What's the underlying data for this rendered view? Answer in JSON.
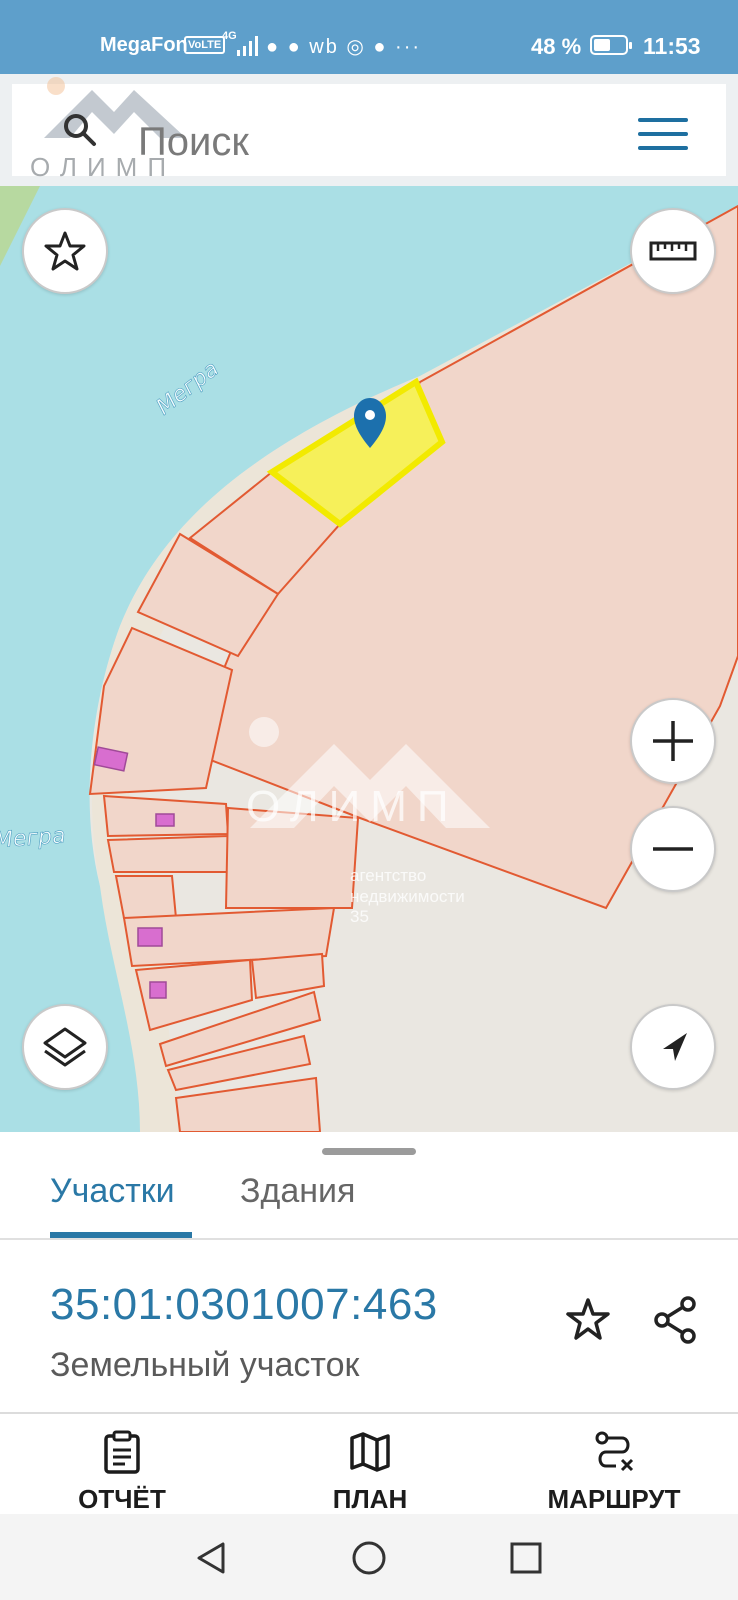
{
  "status_bar": {
    "carrier": "MegaFon",
    "volte": "VoLTE",
    "network": "4G",
    "notifications": "● ● wb ◎ ● ···",
    "battery": "48 %",
    "battery_level": 0.48,
    "time": "11:53"
  },
  "header": {
    "search_placeholder": "Поиск",
    "logo_text": "ОЛИМП"
  },
  "map": {
    "river_name_1": "Мегра",
    "river_name_2": "Мегра",
    "watermark": {
      "name": "ОЛИМП",
      "line1": "агентство",
      "line2": "недвижимости",
      "line3": "35"
    },
    "colors": {
      "water": "#aadfe5",
      "land": "#eae7e1",
      "parcel_fill": "#f1d6ca",
      "parcel_border": "#e25a32",
      "selected_parcel": "#f6f05a",
      "selected_border": "#f2ea00",
      "marker": "#1c70ad",
      "building": "#d86ecf"
    }
  },
  "sheet": {
    "tabs": [
      {
        "label": "Участки",
        "active": true
      },
      {
        "label": "Здания",
        "active": false
      }
    ],
    "parcel": {
      "cadastral_number": "35:01:0301007:463",
      "type": "Земельный участок"
    }
  },
  "actions": [
    {
      "label": "ОТЧЁТ",
      "icon": "clipboard-icon"
    },
    {
      "label": "ПЛАН",
      "icon": "map-icon"
    },
    {
      "label": "МАРШРУТ",
      "icon": "route-icon"
    }
  ],
  "accent_color": "#2a78a6"
}
